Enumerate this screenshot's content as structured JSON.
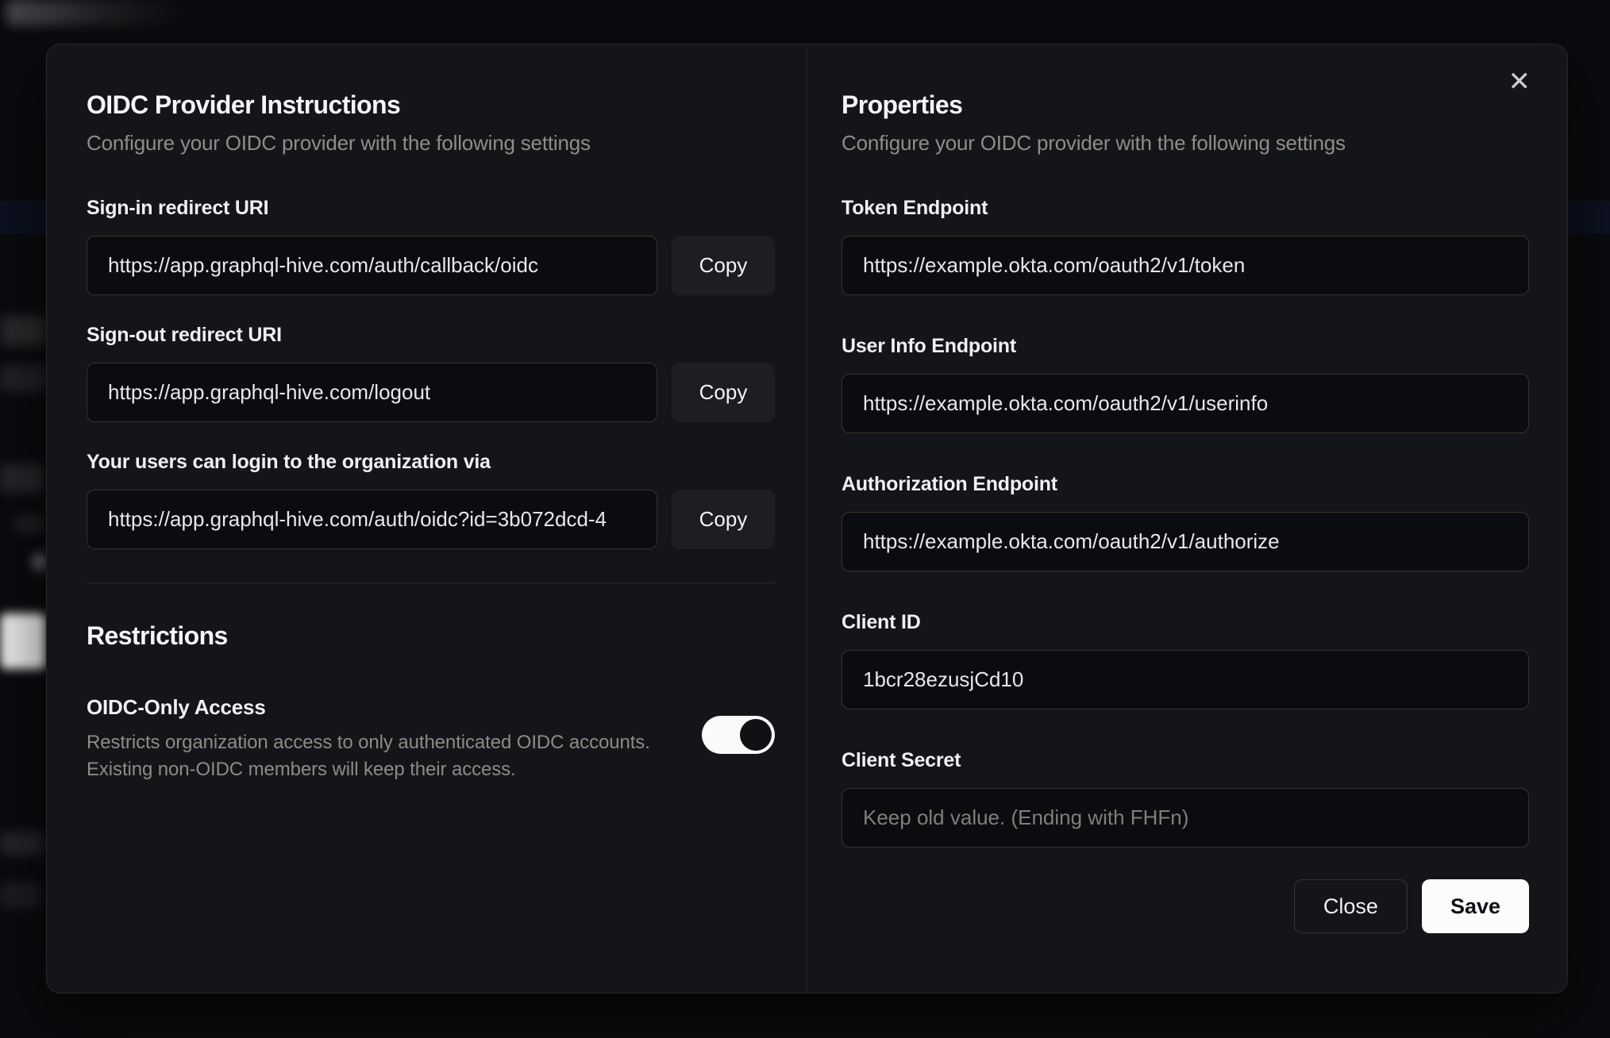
{
  "modal": {
    "close_icon": "✕",
    "left": {
      "title": "OIDC Provider Instructions",
      "subtitle": "Configure your OIDC provider with the following settings",
      "fields": [
        {
          "label": "Sign-in redirect URI",
          "value": "https://app.graphql-hive.com/auth/callback/oidc",
          "copy_label": "Copy"
        },
        {
          "label": "Sign-out redirect URI",
          "value": "https://app.graphql-hive.com/logout",
          "copy_label": "Copy"
        },
        {
          "label": "Your users can login to the organization via",
          "value": "https://app.graphql-hive.com/auth/oidc?id=3b072dcd-4",
          "copy_label": "Copy"
        }
      ],
      "restrictions": {
        "title": "Restrictions",
        "toggle_label": "OIDC-Only Access",
        "description_line1": "Restricts organization access to only authenticated OIDC accounts.",
        "description_line2": "Existing non-OIDC members will keep their access.",
        "toggle_state": "on"
      }
    },
    "right": {
      "title": "Properties",
      "subtitle": "Configure your OIDC provider with the following settings",
      "fields": [
        {
          "label": "Token Endpoint",
          "value": "https://example.okta.com/oauth2/v1/token"
        },
        {
          "label": "User Info Endpoint",
          "value": "https://example.okta.com/oauth2/v1/userinfo"
        },
        {
          "label": "Authorization Endpoint",
          "value": "https://example.okta.com/oauth2/v1/authorize"
        },
        {
          "label": "Client ID",
          "value": "1bcr28ezusjCd10"
        },
        {
          "label": "Client Secret",
          "value": "",
          "placeholder": "Keep old value. (Ending with FHFn)"
        }
      ],
      "buttons": {
        "close": "Close",
        "save": "Save"
      }
    }
  },
  "colors": {
    "page_bg": "#0a0b0e",
    "modal_bg": "#141519",
    "input_bg": "#0b0c10",
    "input_border": "#38322b",
    "copy_button_bg": "#1d1e23",
    "save_button_bg": "#fcfcfd",
    "save_button_text": "#101114",
    "toggle_track_on": "#fafafa",
    "toggle_thumb": "#101114",
    "muted_text": "#8f8d88"
  }
}
